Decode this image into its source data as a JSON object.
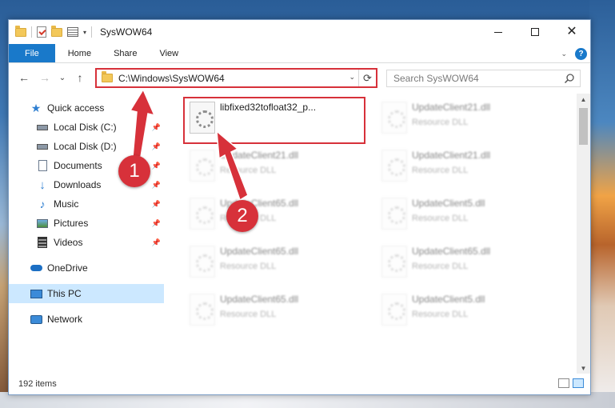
{
  "window": {
    "title": "SysWOW64"
  },
  "ribbon": {
    "tabs": [
      "File",
      "Home",
      "Share",
      "View"
    ],
    "help": "?"
  },
  "address": {
    "path": "C:\\Windows\\SysWOW64",
    "search_placeholder": "Search SysWOW64"
  },
  "nav": {
    "quick_access": "Quick access",
    "items": [
      {
        "label": "Local Disk (C:)",
        "icon": "drive-icon",
        "pinned": true
      },
      {
        "label": "Local Disk (D:)",
        "icon": "drive-icon",
        "pinned": true
      },
      {
        "label": "Documents",
        "icon": "documents-icon",
        "pinned": true
      },
      {
        "label": "Downloads",
        "icon": "download-icon",
        "pinned": true
      },
      {
        "label": "Music",
        "icon": "music-icon",
        "pinned": true
      },
      {
        "label": "Pictures",
        "icon": "pictures-icon",
        "pinned": true
      },
      {
        "label": "Videos",
        "icon": "videos-icon",
        "pinned": true
      }
    ],
    "onedrive": "OneDrive",
    "this_pc": "This PC",
    "network": "Network"
  },
  "files": {
    "highlighted": {
      "name": "libfixed32tofloat32_p..."
    },
    "left_col": [
      {
        "name": "UpdateClient21.dll",
        "desc": "Resource DLL"
      },
      {
        "name": "UpdateClient65.dll",
        "desc": "Resource DLL"
      },
      {
        "name": "UpdateClient65.dll",
        "desc": "Resource DLL"
      },
      {
        "name": "UpdateClient65.dll",
        "desc": "Resource DLL"
      }
    ],
    "right_col": [
      {
        "name": "UpdateClient21.dll",
        "desc": "Resource DLL"
      },
      {
        "name": "UpdateClient21.dll",
        "desc": "Resource DLL"
      },
      {
        "name": "UpdateClient5.dll",
        "desc": "Resource DLL"
      },
      {
        "name": "UpdateClient65.dll",
        "desc": "Resource DLL"
      },
      {
        "name": "UpdateClient5.dll",
        "desc": "Resource DLL"
      }
    ]
  },
  "status": {
    "item_count": "192 items"
  },
  "annotations": {
    "step1": "1",
    "step2": "2",
    "color": "#d7313a"
  }
}
